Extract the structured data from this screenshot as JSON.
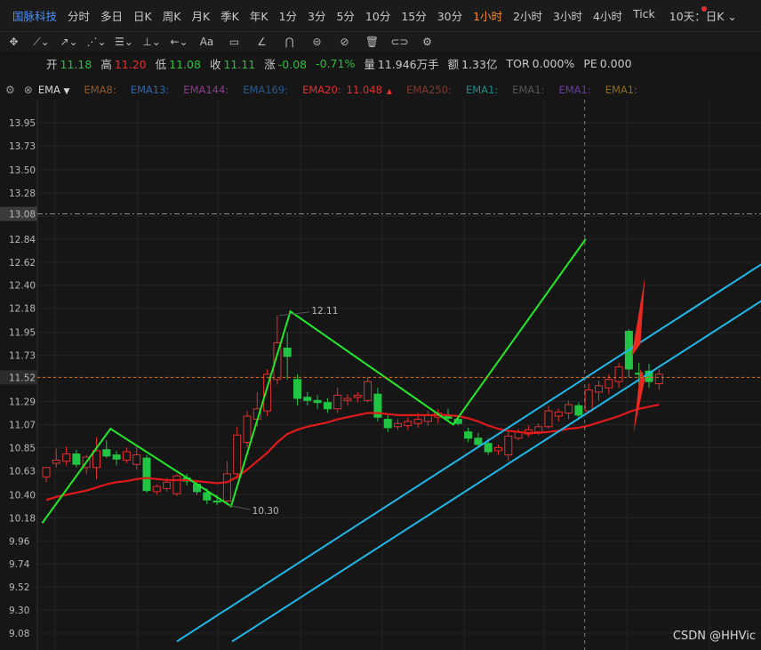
{
  "stock_name": "国脉科技",
  "periods": [
    {
      "label": "分时",
      "active": false
    },
    {
      "label": "多日",
      "active": false
    },
    {
      "label": "日K",
      "active": false
    },
    {
      "label": "周K",
      "active": false
    },
    {
      "label": "月K",
      "active": false
    },
    {
      "label": "季K",
      "active": false
    },
    {
      "label": "年K",
      "active": false
    },
    {
      "label": "1分",
      "active": false
    },
    {
      "label": "3分",
      "active": false
    },
    {
      "label": "5分",
      "active": false
    },
    {
      "label": "10分",
      "active": false
    },
    {
      "label": "15分",
      "active": false
    },
    {
      "label": "30分",
      "active": false
    },
    {
      "label": "1小时",
      "active": true
    },
    {
      "label": "2小时",
      "active": false
    },
    {
      "label": "3小时",
      "active": false
    },
    {
      "label": "4小时",
      "active": false
    },
    {
      "label": "Tick",
      "active": false
    }
  ],
  "multi_select": "10天：日K",
  "tools": [
    {
      "icon": "move-icon",
      "glyph": "✥"
    },
    {
      "icon": "line-icon",
      "glyph": "⟋⌄"
    },
    {
      "icon": "ray-icon",
      "glyph": "↗⌄"
    },
    {
      "icon": "wave-icon",
      "glyph": "⋰⌄"
    },
    {
      "icon": "fib-icon",
      "glyph": "☰⌄"
    },
    {
      "icon": "measure-icon",
      "glyph": "⊥⌄"
    },
    {
      "icon": "arrow-icon",
      "glyph": "←⌄"
    },
    {
      "icon": "text-icon",
      "glyph": "Aa"
    },
    {
      "icon": "comment-icon",
      "glyph": "▭"
    },
    {
      "icon": "angle-icon",
      "glyph": "∠"
    },
    {
      "icon": "magnet-icon",
      "glyph": "⋂"
    },
    {
      "icon": "lock-icon",
      "glyph": "⊜"
    },
    {
      "icon": "hide-icon",
      "glyph": "⊘"
    },
    {
      "icon": "trash-icon",
      "glyph": "🗑"
    },
    {
      "icon": "link-icon",
      "glyph": "⊂⊃"
    },
    {
      "icon": "settings-icon",
      "glyph": "⚙"
    }
  ],
  "quote": [
    {
      "label": "开",
      "value": "11.18",
      "tone": "down"
    },
    {
      "label": "高",
      "value": "11.20",
      "tone": "up"
    },
    {
      "label": "低",
      "value": "11.08",
      "tone": "down"
    },
    {
      "label": "收",
      "value": "11.11",
      "tone": "down"
    },
    {
      "label": "涨",
      "value": "-0.08",
      "tone": "down"
    },
    {
      "label": "",
      "value": "-0.71%",
      "tone": "down"
    },
    {
      "label": "量",
      "value": "11.946万手",
      "tone": "neu"
    },
    {
      "label": "额",
      "value": "1.33亿",
      "tone": "neu"
    },
    {
      "label": "TOR",
      "value": "0.000%",
      "tone": "neu"
    },
    {
      "label": "PE",
      "value": "0.000",
      "tone": "neu"
    }
  ],
  "indicator": "EMA",
  "ema_legend": [
    {
      "label": "EMA8:",
      "value": "",
      "color": "#8e5a28"
    },
    {
      "label": "EMA13:",
      "value": "",
      "color": "#2e66a8"
    },
    {
      "label": "EMA144:",
      "value": "",
      "color": "#8e3c8e"
    },
    {
      "label": "EMA169:",
      "value": "",
      "color": "#2a5a8c"
    },
    {
      "label": "EMA20:",
      "value": "11.048",
      "color": "#e0302f",
      "arrow": "▲"
    },
    {
      "label": "EMA250:",
      "value": "",
      "color": "#7e3a30"
    },
    {
      "label": "EMA1:",
      "value": "",
      "color": "#1e8a8a"
    },
    {
      "label": "EMA1:",
      "value": "",
      "color": "#555555"
    },
    {
      "label": "EMA1:",
      "value": "",
      "color": "#6a3aa0"
    },
    {
      "label": "EMA1:",
      "value": "",
      "color": "#8a6a1e"
    }
  ],
  "chart_data": {
    "type": "candlestick",
    "y_ticks": [
      "13.95",
      "13.73",
      "13.50",
      "13.28",
      "13.06",
      "12.84",
      "12.62",
      "12.40",
      "12.18",
      "11.95",
      "11.73",
      "11.52",
      "11.29",
      "11.07",
      "10.85",
      "10.63",
      "10.40",
      "10.18",
      "9.96",
      "9.74",
      "9.52",
      "9.30",
      "9.08"
    ],
    "ylim": [
      9.0,
      14.1
    ],
    "crosshair_price": "13.08",
    "last_price": "11.52",
    "annotations": [
      {
        "text": "12.11",
        "price": 12.11
      },
      {
        "text": "10.30",
        "price": 10.3
      }
    ],
    "candles": [
      {
        "o": 10.57,
        "h": 10.66,
        "l": 10.52,
        "c": 10.66
      },
      {
        "o": 10.7,
        "h": 10.84,
        "l": 10.66,
        "c": 10.73
      },
      {
        "o": 10.72,
        "h": 10.86,
        "l": 10.68,
        "c": 10.79
      },
      {
        "o": 10.79,
        "h": 10.83,
        "l": 10.66,
        "c": 10.69
      },
      {
        "o": 10.66,
        "h": 10.78,
        "l": 10.6,
        "c": 10.76
      },
      {
        "o": 10.66,
        "h": 10.95,
        "l": 10.55,
        "c": 10.82
      },
      {
        "o": 10.83,
        "h": 10.92,
        "l": 10.75,
        "c": 10.77
      },
      {
        "o": 10.78,
        "h": 10.82,
        "l": 10.68,
        "c": 10.74
      },
      {
        "o": 10.73,
        "h": 10.85,
        "l": 10.7,
        "c": 10.81
      },
      {
        "o": 10.69,
        "h": 10.86,
        "l": 10.64,
        "c": 10.78
      },
      {
        "o": 10.75,
        "h": 10.78,
        "l": 10.42,
        "c": 10.44
      },
      {
        "o": 10.43,
        "h": 10.5,
        "l": 10.4,
        "c": 10.48
      },
      {
        "o": 10.46,
        "h": 10.56,
        "l": 10.43,
        "c": 10.52
      },
      {
        "o": 10.41,
        "h": 10.6,
        "l": 10.39,
        "c": 10.58
      },
      {
        "o": 10.56,
        "h": 10.6,
        "l": 10.49,
        "c": 10.53
      },
      {
        "o": 10.5,
        "h": 10.52,
        "l": 10.4,
        "c": 10.43
      },
      {
        "o": 10.42,
        "h": 10.46,
        "l": 10.31,
        "c": 10.35
      },
      {
        "o": 10.34,
        "h": 10.4,
        "l": 10.3,
        "c": 10.33
      },
      {
        "o": 10.34,
        "h": 10.72,
        "l": 10.32,
        "c": 10.6
      },
      {
        "o": 10.6,
        "h": 11.05,
        "l": 10.55,
        "c": 10.97
      },
      {
        "o": 10.9,
        "h": 11.2,
        "l": 10.85,
        "c": 11.15
      },
      {
        "o": 11.12,
        "h": 11.38,
        "l": 11.05,
        "c": 11.22
      },
      {
        "o": 11.2,
        "h": 11.6,
        "l": 11.15,
        "c": 11.55
      },
      {
        "o": 11.5,
        "h": 12.11,
        "l": 11.45,
        "c": 11.85
      },
      {
        "o": 11.8,
        "h": 11.95,
        "l": 11.5,
        "c": 11.72
      },
      {
        "o": 11.5,
        "h": 11.55,
        "l": 11.25,
        "c": 11.32
      },
      {
        "o": 11.33,
        "h": 11.38,
        "l": 11.25,
        "c": 11.3
      },
      {
        "o": 11.3,
        "h": 11.35,
        "l": 11.22,
        "c": 11.28
      },
      {
        "o": 11.28,
        "h": 11.32,
        "l": 11.18,
        "c": 11.22
      },
      {
        "o": 11.22,
        "h": 11.42,
        "l": 11.18,
        "c": 11.35
      },
      {
        "o": 11.3,
        "h": 11.36,
        "l": 11.25,
        "c": 11.32
      },
      {
        "o": 11.33,
        "h": 11.38,
        "l": 11.28,
        "c": 11.35
      },
      {
        "o": 11.3,
        "h": 11.52,
        "l": 11.28,
        "c": 11.48
      },
      {
        "o": 11.36,
        "h": 11.42,
        "l": 11.1,
        "c": 11.14
      },
      {
        "o": 11.12,
        "h": 11.16,
        "l": 11.0,
        "c": 11.04
      },
      {
        "o": 11.05,
        "h": 11.12,
        "l": 11.02,
        "c": 11.08
      },
      {
        "o": 11.06,
        "h": 11.14,
        "l": 11.02,
        "c": 11.1
      },
      {
        "o": 11.08,
        "h": 11.18,
        "l": 11.04,
        "c": 11.12
      },
      {
        "o": 11.1,
        "h": 11.2,
        "l": 11.06,
        "c": 11.16
      },
      {
        "o": 11.14,
        "h": 11.22,
        "l": 11.08,
        "c": 11.18
      },
      {
        "o": 11.16,
        "h": 11.22,
        "l": 11.1,
        "c": 11.13
      },
      {
        "o": 11.12,
        "h": 11.15,
        "l": 11.06,
        "c": 11.08
      },
      {
        "o": 11.0,
        "h": 11.04,
        "l": 10.9,
        "c": 10.94
      },
      {
        "o": 10.94,
        "h": 10.99,
        "l": 10.86,
        "c": 10.88
      },
      {
        "o": 10.89,
        "h": 10.94,
        "l": 10.78,
        "c": 10.81
      },
      {
        "o": 10.82,
        "h": 10.88,
        "l": 10.78,
        "c": 10.85
      },
      {
        "o": 10.78,
        "h": 11.0,
        "l": 10.72,
        "c": 10.96
      },
      {
        "o": 10.94,
        "h": 11.03,
        "l": 10.92,
        "c": 11.0
      },
      {
        "o": 10.98,
        "h": 11.06,
        "l": 10.95,
        "c": 11.02
      },
      {
        "o": 11.0,
        "h": 11.08,
        "l": 10.97,
        "c": 11.05
      },
      {
        "o": 11.05,
        "h": 11.25,
        "l": 11.03,
        "c": 11.2
      },
      {
        "o": 11.15,
        "h": 11.22,
        "l": 11.1,
        "c": 11.19
      },
      {
        "o": 11.18,
        "h": 11.3,
        "l": 11.12,
        "c": 11.26
      },
      {
        "o": 11.25,
        "h": 11.28,
        "l": 11.12,
        "c": 11.16
      },
      {
        "o": 11.2,
        "h": 11.46,
        "l": 11.18,
        "c": 11.4
      },
      {
        "o": 11.38,
        "h": 11.49,
        "l": 11.3,
        "c": 11.44
      },
      {
        "o": 11.42,
        "h": 11.55,
        "l": 11.36,
        "c": 11.5
      },
      {
        "o": 11.48,
        "h": 11.66,
        "l": 11.42,
        "c": 11.62
      },
      {
        "o": 11.96,
        "h": 11.98,
        "l": 11.52,
        "c": 11.6
      },
      {
        "o": 11.56,
        "h": 11.66,
        "l": 11.45,
        "c": 11.55
      },
      {
        "o": 11.58,
        "h": 11.65,
        "l": 11.42,
        "c": 11.48
      },
      {
        "o": 11.46,
        "h": 11.6,
        "l": 11.4,
        "c": 11.55
      }
    ],
    "ema20": [
      10.35,
      10.38,
      10.4,
      10.42,
      10.44,
      10.47,
      10.5,
      10.52,
      10.53,
      10.55,
      10.56,
      10.55,
      10.54,
      10.54,
      10.54,
      10.53,
      10.52,
      10.51,
      10.52,
      10.57,
      10.64,
      10.72,
      10.8,
      10.9,
      10.98,
      11.02,
      11.05,
      11.07,
      11.09,
      11.12,
      11.14,
      11.16,
      11.18,
      11.18,
      11.17,
      11.16,
      11.16,
      11.16,
      11.16,
      11.16,
      11.16,
      11.15,
      11.13,
      11.1,
      11.06,
      11.03,
      11.01,
      11.0,
      10.99,
      10.99,
      11.0,
      11.01,
      11.03,
      11.04,
      11.06,
      11.09,
      11.12,
      11.15,
      11.19,
      11.22,
      11.24,
      11.26
    ]
  },
  "watermark": "CSDN @HHVic"
}
